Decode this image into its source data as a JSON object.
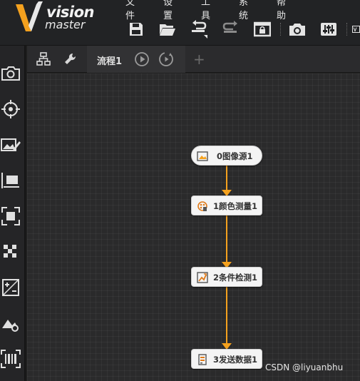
{
  "app": {
    "logo_word_1": "vision",
    "logo_word_2": "master"
  },
  "menu": {
    "file": "文件",
    "settings": "设置",
    "tools": "工具",
    "system": "系统",
    "help": "帮助"
  },
  "toolbar": {
    "icons": [
      "save-icon",
      "open-folder-icon",
      "undo-icon",
      "redo-icon",
      "lock-window-icon",
      "camera-icon",
      "controller-settings-icon",
      "variable-icon"
    ]
  },
  "left_tools": [
    "camera-icon",
    "target-locate-icon",
    "image-edit-icon",
    "measure-icon",
    "roi-icon",
    "checker-icon",
    "calculate-icon",
    "image-settings-icon",
    "barcode-icon"
  ],
  "tabs": {
    "flow_label": "流程1",
    "add_label": "+"
  },
  "flow": {
    "nodes": [
      {
        "label": "0图像源1",
        "icon": "image-source-icon"
      },
      {
        "label": "1颜色测量1",
        "icon": "color-measure-icon"
      },
      {
        "label": "2条件检测1",
        "icon": "condition-check-icon"
      },
      {
        "label": "3发送数据1",
        "icon": "send-data-icon"
      }
    ],
    "connector_color": "#f4a11e"
  },
  "watermark": "CSDN @liyuanbhu",
  "colors": {
    "accent": "#f4a11e",
    "node_bg": "#f4f4f4",
    "canvas_bg": "#2a2a2b"
  }
}
